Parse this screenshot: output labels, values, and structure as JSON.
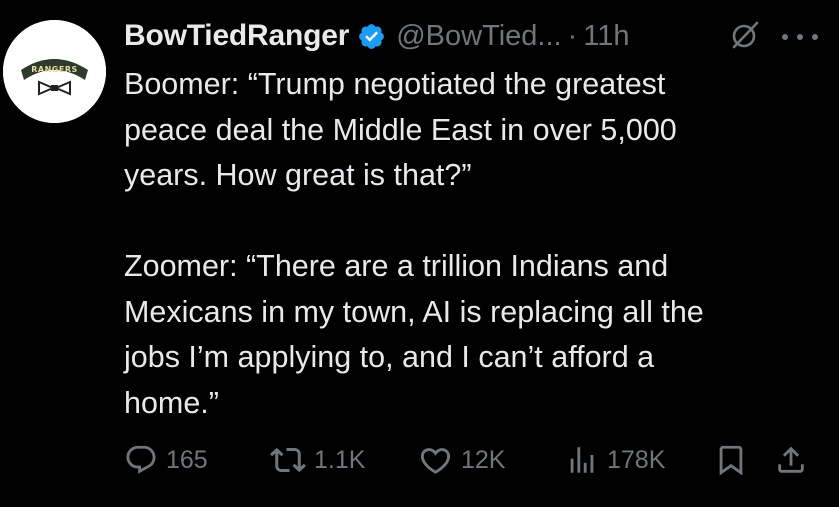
{
  "author": {
    "display_name": "BowTiedRanger",
    "handle": "@BowTied...",
    "separator": "·",
    "timestamp": "11h",
    "verified": true,
    "avatar_text": "RANGERS"
  },
  "tweet": {
    "text": "Boomer: “Trump negotiated the greatest\npeace deal the Middle East in over 5,000\nyears. How great is that?”\n\nZoomer: “There are a trillion Indians and\nMexicans in my town, AI is replacing all the\njobs I’m applying to, and I can’t afford a\nhome.”"
  },
  "actions": {
    "replies": "165",
    "reposts": "1.1K",
    "likes": "12K",
    "views": "178K"
  },
  "icons": {
    "verified": "verified-badge-icon",
    "grok": "grok-icon",
    "more": "more-icon",
    "reply": "reply-icon",
    "repost": "repost-icon",
    "like": "heart-icon",
    "views": "views-chart-icon",
    "bookmark": "bookmark-icon",
    "share": "share-icon"
  },
  "colors": {
    "background": "#000000",
    "text_primary": "#e7e9ea",
    "text_secondary": "#71767b",
    "verified_blue": "#1d9bf0"
  }
}
